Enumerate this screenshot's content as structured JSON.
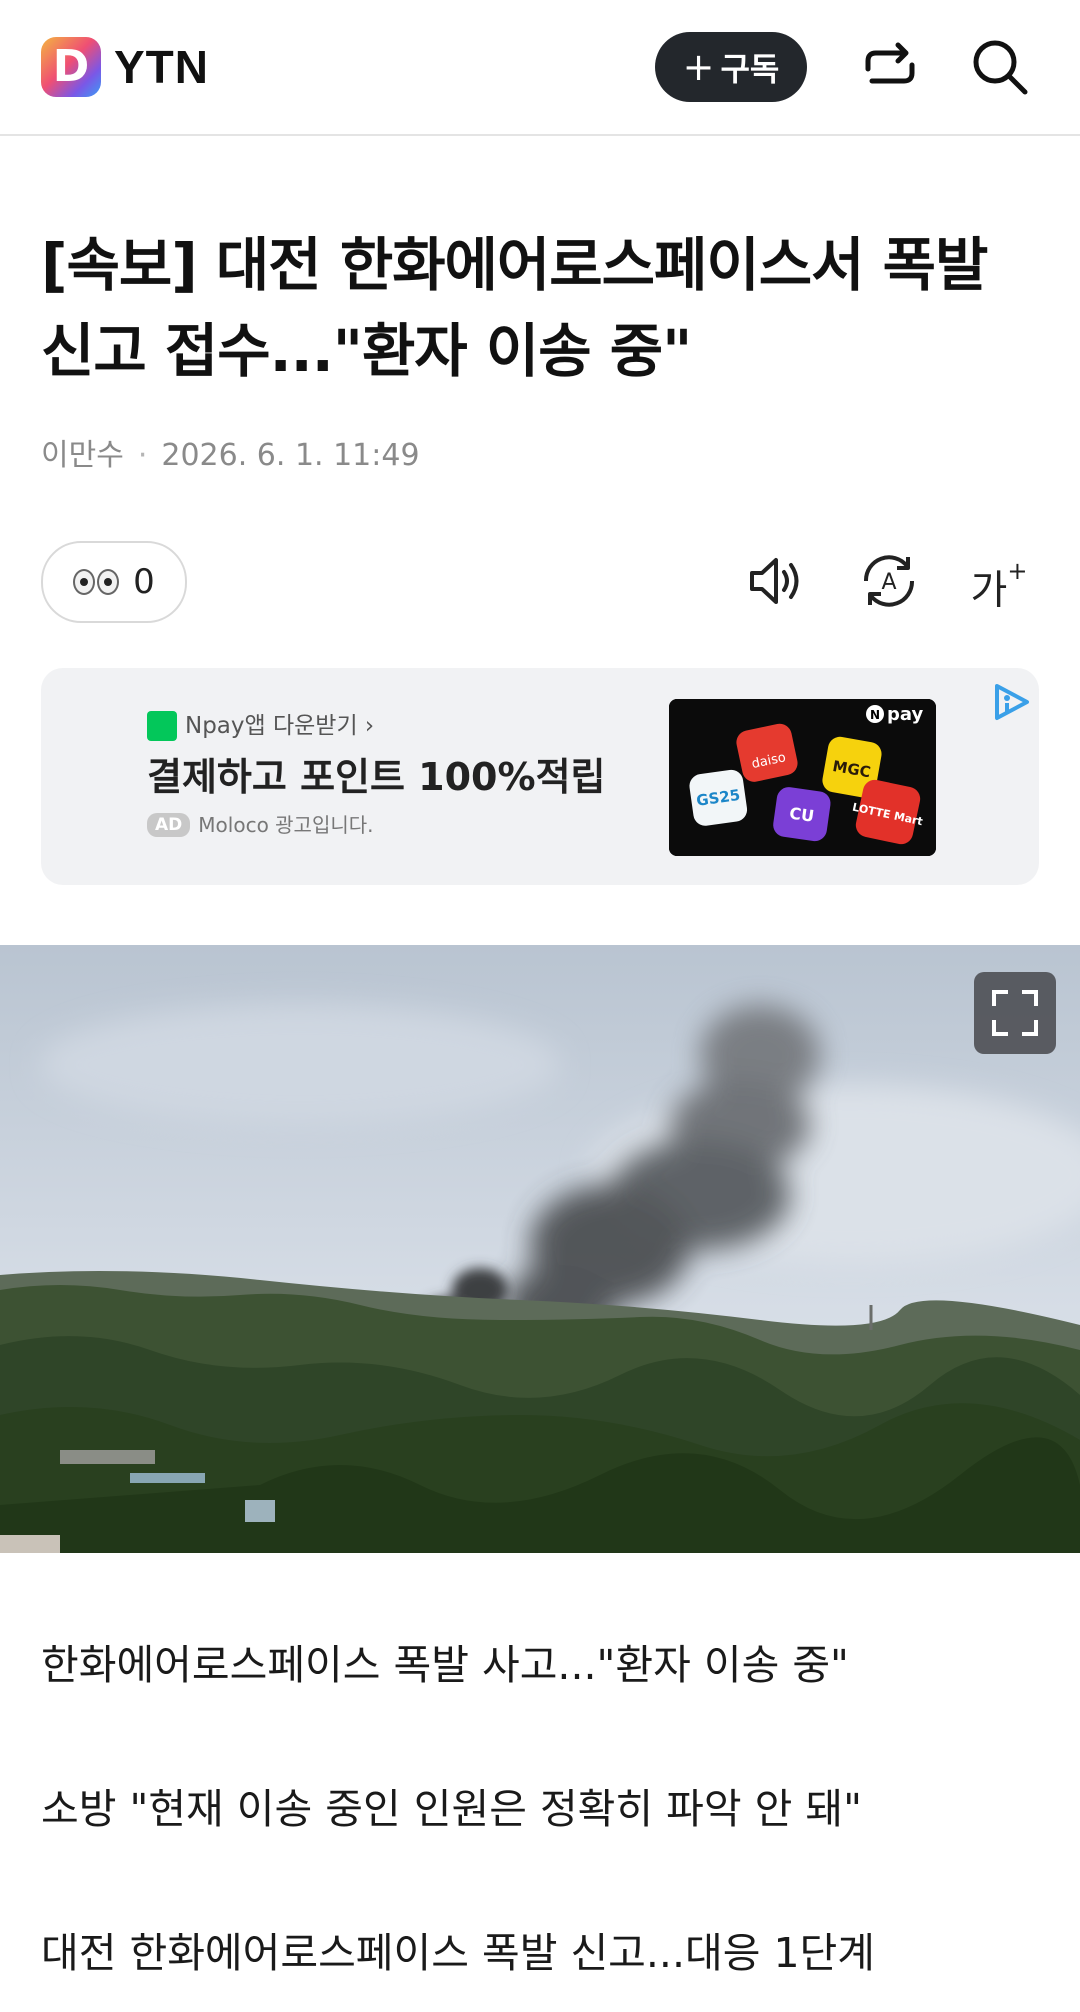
{
  "header": {
    "logo_text": "YTN",
    "subscribe_label": "구독",
    "subscribe_icon": "plus-icon",
    "share_icon": "share-icon",
    "search_icon": "search-icon"
  },
  "article": {
    "title_line1": "[속보] 대전 한화에어로스페이스서 폭발",
    "title_line2": "신고 접수...\"환자 이송 중\"",
    "author": "이만수",
    "datetime": "2026. 6. 1. 11:49",
    "reaction_count": "0",
    "tools": {
      "audio_icon": "speaker-icon",
      "translate_icon": "translate-icon",
      "font_label": "가"
    }
  },
  "ad": {
    "npay_label": "Npay앱 다운받기 ›",
    "headline": "결제하고 포인트 100%적립",
    "badge": "AD",
    "advertiser": "Moloco 광고입니다.",
    "image_brand": "pay",
    "image_tiles": [
      "daiso",
      "GS25",
      "CU",
      "LOTTE Mart",
      "MGC"
    ],
    "choice_icon": "adchoices-icon"
  },
  "photo": {
    "expand_icon": "fullscreen-icon"
  },
  "related": [
    "한화에어로스페이스 폭발 사고...\"환자 이송 중\"",
    "소방 \"현재 이송 중인 인원은 정확히 파악 안 돼\"",
    "대전 한화에어로스페이스 폭발 신고...대응 1단계"
  ]
}
